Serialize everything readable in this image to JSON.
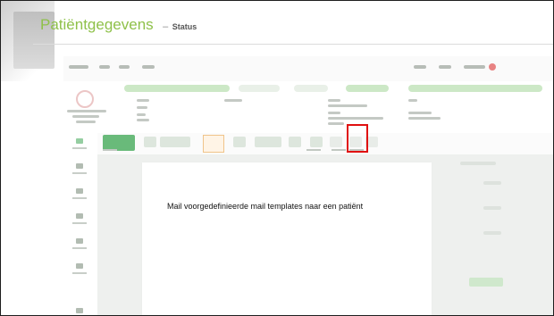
{
  "slide": {
    "title": "Patiëntgegevens",
    "separator": "–",
    "subtitle": "Status",
    "caption": "Mail voorgedefinieerde mail templates naar een patiënt"
  },
  "colors": {
    "title_accent": "#8fc14a",
    "highlight_border": "#e01010",
    "app_primary": "#4fae63"
  }
}
